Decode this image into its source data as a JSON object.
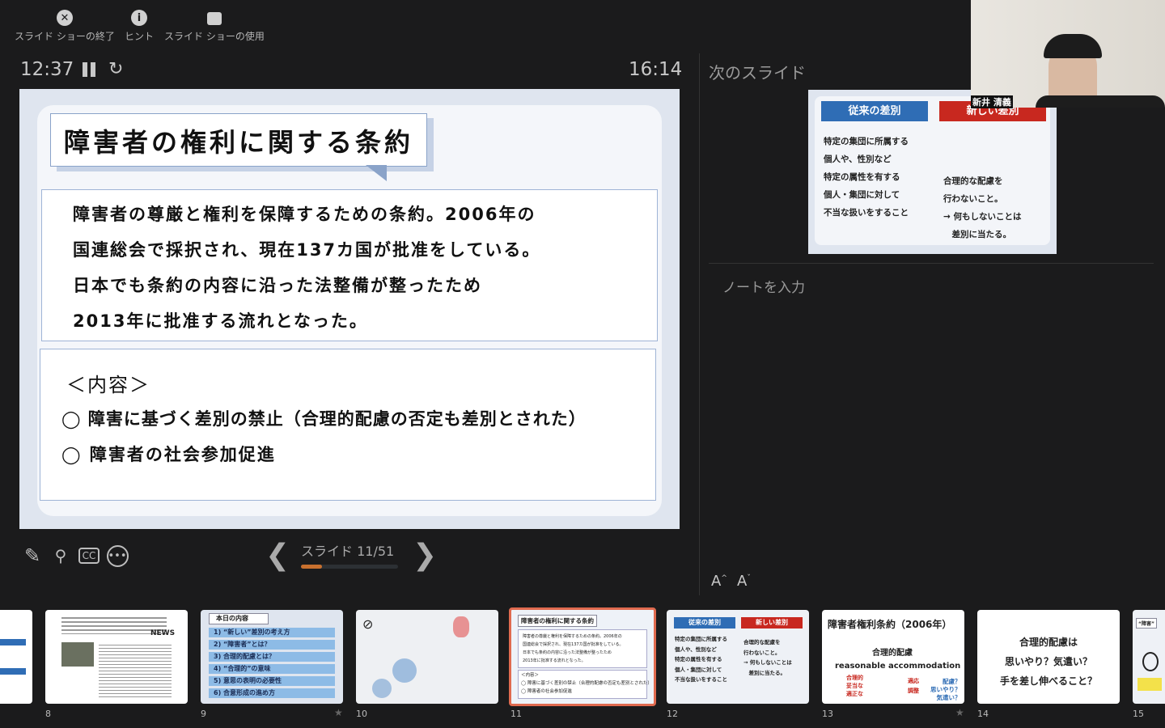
{
  "toolbar": {
    "end_show": "スライド ショーの終了",
    "hints": "ヒント",
    "use_show": "スライド ショーの使用"
  },
  "timers": {
    "elapsed": "12:37",
    "clock": "16:14"
  },
  "current_slide": {
    "title": "障害者の権利に関する条約",
    "body": [
      "障害者の尊厳と権利を保障するための条約。2006年の",
      "国連総会で採択され、現在137カ国が批准をしている。",
      "日本でも条約の内容に沿った法整備が整ったため",
      "2013年に批准する流れとなった。"
    ],
    "contents_heading": "＜内容＞",
    "contents": [
      "◯ 障害に基づく差別の禁止（合理的配慮の否定も差別とされた）",
      "◯ 障害者の社会参加促進"
    ]
  },
  "next": {
    "label": "次のスライド",
    "left_header": "従来の差別",
    "right_header": "新しい差別",
    "left_lines": [
      "特定の集団に所属する",
      "個人や、性別など",
      "特定の属性を有する",
      "個人・集団に対して",
      "不当な扱いをすること"
    ],
    "right_lines": [
      "合理的な配慮を",
      "行わないこと。",
      "→ 何もしないことは",
      "　差別に当たる。"
    ],
    "colors": {
      "blue": "#2f6db5",
      "red": "#c8281f"
    }
  },
  "webcam": {
    "name": "新井 清義"
  },
  "notes": {
    "placeholder": "ノートを入力"
  },
  "nav": {
    "slide_label": "スライド 11/51",
    "progress": 0.22,
    "accent": "#c8702e"
  },
  "thumbnails": [
    {
      "num": "8",
      "news": "NEWS"
    },
    {
      "num": "9",
      "starred": true,
      "title": "本日の内容",
      "items": [
        "1) “新しい”差別の考え方",
        "2) “障害者”とは？",
        "3) 合理的配慮とは？",
        "4) “合理的”の意味",
        "5) 意思の表明の必要性",
        "6) 合意形成の進め方"
      ]
    },
    {
      "num": "10"
    },
    {
      "num": "11",
      "selected": true,
      "title": "障害者の権利に関する条約",
      "heading": "＜内容＞"
    },
    {
      "num": "12",
      "left": "従来の差別",
      "right": "新しい差別"
    },
    {
      "num": "13",
      "starred": true,
      "title": "障害者権利条約（2006年）",
      "sub": "合理的配慮",
      "en": "reasonable  accommodation",
      "red1": [
        "合理的",
        "妥当な",
        "適正な"
      ],
      "red2": [
        "適応",
        "調整"
      ],
      "blue": [
        "配慮？",
        "思いやり？",
        "気遣い？"
      ]
    },
    {
      "num": "14",
      "lines": [
        "合理的配慮は",
        "思いやり？気遣い？",
        "手を差し伸べること？"
      ]
    },
    {
      "num": "15",
      "title": "“障害”"
    }
  ]
}
